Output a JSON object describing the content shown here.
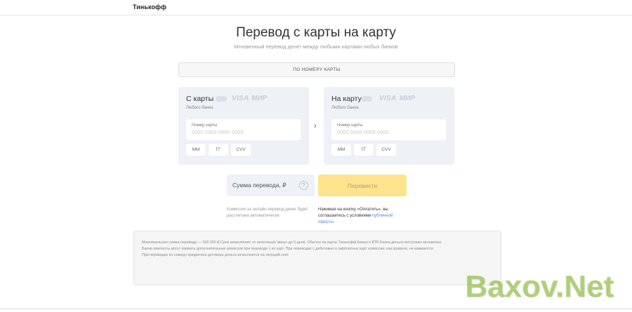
{
  "header": {
    "logo": "Тинькофф"
  },
  "main": {
    "title": "Перевод с карты на карту",
    "subtitle": "Мгновенный перевод денег между любыми картами любых банков",
    "mode_tab": "ПО НОМЕРУ КАРТЫ"
  },
  "card_from": {
    "title": "С карты",
    "visa": "VISA",
    "mir": "МИР",
    "subtitle": "Любого банка",
    "number_label": "Номер карты",
    "number_placeholder": "0000 0000 0000 0000",
    "mm_placeholder": "ММ",
    "yy_placeholder": "ГГ",
    "cvv_placeholder": "CVV"
  },
  "card_to": {
    "title": "На карту",
    "visa": "VISA",
    "mir": "МИР",
    "subtitle": "Любого банка",
    "number_label": "Номер карты",
    "number_placeholder": "0000 0000 0000 0000",
    "mm_placeholder": "ММ",
    "yy_placeholder": "ГГ",
    "cvv_placeholder": "CVV"
  },
  "icons": {
    "arrow": "chevron-right-icon",
    "help": "question-icon"
  },
  "arrow_glyph": "›",
  "amount": {
    "placeholder": "Сумма перевода, ₽",
    "help_glyph": "?"
  },
  "submit": {
    "label": "Перевести",
    "color": "#fde38c"
  },
  "notes": {
    "commission": "Комиссия за онлайн-перевод денег будет рассчитана автоматически",
    "agree_text": "Нажимая на кнопку «Оплатить», вы соглашаетесь с условиями",
    "agree_link": "публичной оферты"
  },
  "info": {
    "line1": "Максимальная сумма перевода — 500 000 ₽.Срок зачисления: от нескольких минут до 5 дней. Обычно на карты Тинькофф Банка и ВТБ Банка деньги поступают мгновенно.",
    "line2": "Банки-эмитенты могут взимать дополнительные комиссии при переводе с их карт. При переводах с дебетовых и зарплатных карт комиссии, как правило, не взимаются.",
    "line3": "При переводах по номеру кредитного договора деньги зачисляются на текущий счет."
  },
  "watermark": "Baxov.Net",
  "colors": {
    "accent": "#fde38c",
    "link": "#4a8fd6",
    "panel": "#eef1f6"
  }
}
